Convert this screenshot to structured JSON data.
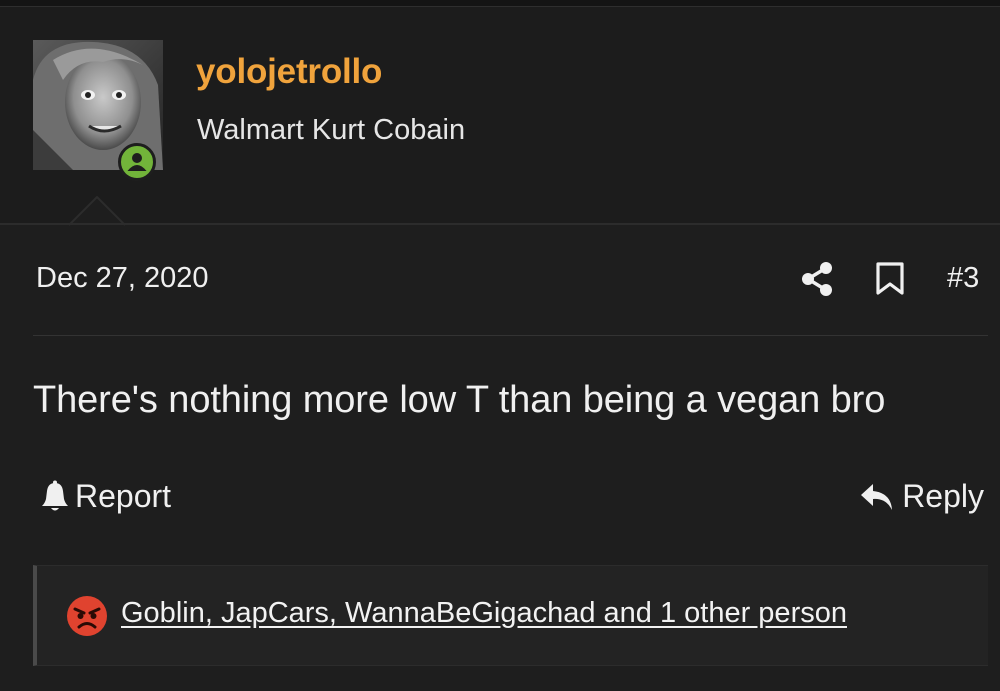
{
  "post": {
    "username": "yolojetrollo",
    "user_title": "Walmart Kurt Cobain",
    "date": "Dec 27, 2020",
    "number": "#3",
    "body": "There's nothing more low T than being a vegan bro",
    "status": "online"
  },
  "actions": {
    "report_label": "Report",
    "reply_label": "Reply",
    "share_icon": "share-icon",
    "bookmark_icon": "bookmark-icon"
  },
  "reactions": {
    "emoji": "angry-face",
    "users_text": "Goblin, JapCars, WannaBeGigachad and 1 other person"
  },
  "colors": {
    "username": "#f0a33c",
    "online": "#72b43a",
    "background": "#1e1e1e",
    "angry": "#e0432f"
  }
}
